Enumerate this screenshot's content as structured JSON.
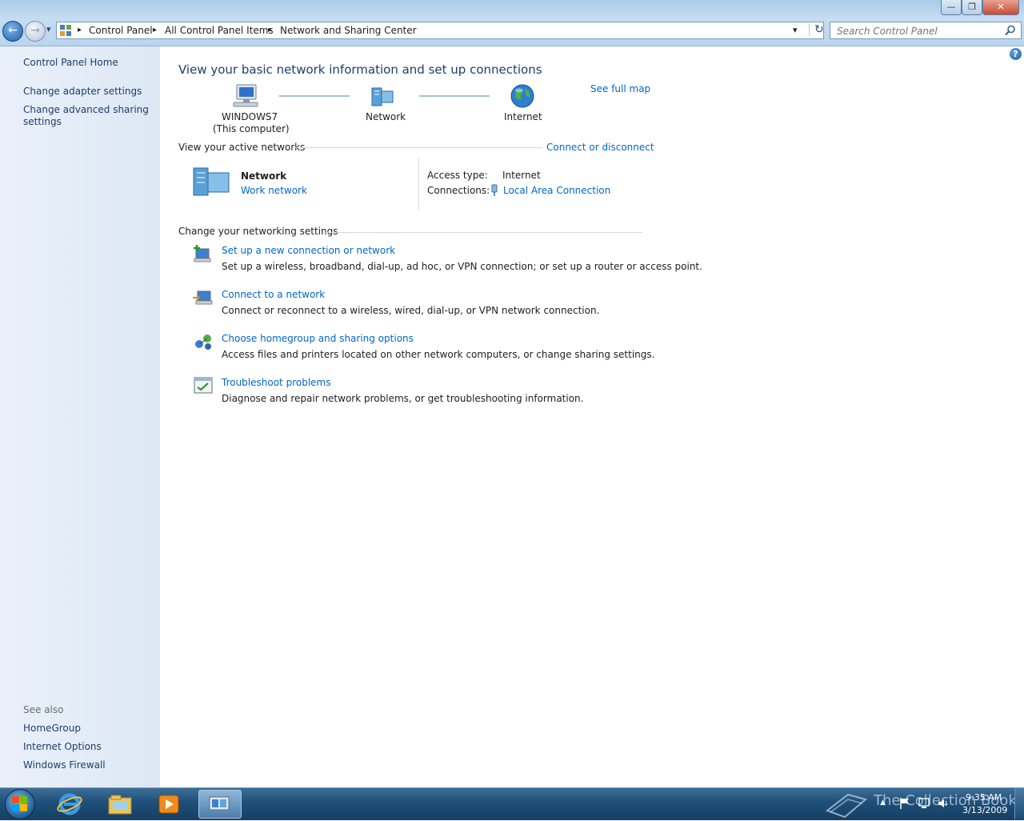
{
  "window": {
    "minimize_glyph": "—",
    "restore_glyph": "❐",
    "close_glyph": "✕"
  },
  "nav": {
    "back_glyph": "←",
    "forward_glyph": "→",
    "dropdown_glyph": "▾",
    "refresh_glyph": "↻",
    "breadcrumb": [
      "Control Panel",
      "All Control Panel Items",
      "Network and Sharing Center"
    ],
    "separator_glyph": "▸",
    "search_placeholder": "Search Control Panel",
    "search_icon": "search-icon"
  },
  "sidebar": {
    "home": "Control Panel Home",
    "links": [
      "Change adapter settings",
      "Change advanced sharing",
      "settings"
    ],
    "see_also_title": "See also",
    "see_also": [
      "HomeGroup",
      "Internet Options",
      "Windows Firewall"
    ]
  },
  "main": {
    "title": "View your basic network information and set up connections",
    "see_full_map": "See full map",
    "map": {
      "computer_name": "WINDOWS7",
      "computer_sub": "(This computer)",
      "network": "Network",
      "internet": "Internet"
    },
    "active": {
      "heading": "View your active networks",
      "connect_link": "Connect or disconnect",
      "network_name": "Network",
      "network_type": "Work network",
      "access_label": "Access type:",
      "access_value": "Internet",
      "connections_label": "Connections:",
      "connections_value": "Local Area Connection"
    },
    "settings": {
      "heading": "Change your networking settings",
      "items": [
        {
          "title": "Set up a new connection or network",
          "desc": "Set up a wireless, broadband, dial-up, ad hoc, or VPN connection; or set up a router or access point."
        },
        {
          "title": "Connect to a network",
          "desc": "Connect or reconnect to a wireless, wired, dial-up, or VPN network connection."
        },
        {
          "title": "Choose homegroup and sharing options",
          "desc": "Access files and printers located on other network computers, or change sharing settings."
        },
        {
          "title": "Troubleshoot problems",
          "desc": "Diagnose and repair network problems, or get troubleshooting information."
        }
      ]
    },
    "help_glyph": "?"
  },
  "taskbar": {
    "time": "9:35 AM",
    "date": "3/13/2009",
    "watermark": "The Collection Book",
    "tray_expand_glyph": "▲"
  },
  "colors": {
    "link": "#0066cc",
    "title": "#1e3d6e",
    "sidebar": "#e4edf7",
    "taskbar": "#1e4e78"
  }
}
